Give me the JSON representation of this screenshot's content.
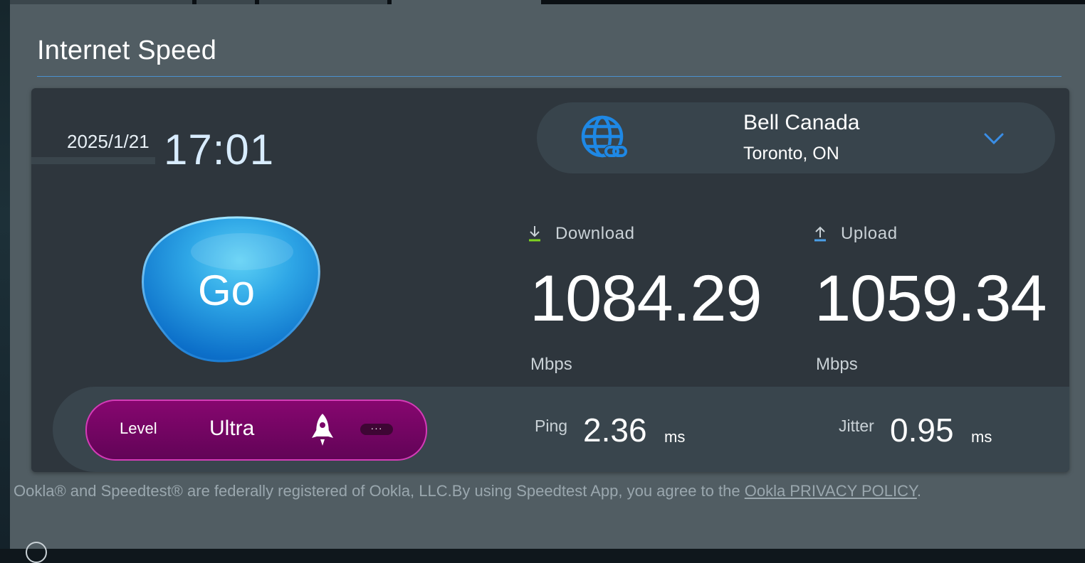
{
  "section": {
    "title": "Internet Speed"
  },
  "datetime": {
    "date": "2025/1/21",
    "time": "17:01"
  },
  "server": {
    "isp": "Bell Canada",
    "location": "Toronto, ON",
    "icon": "globe-link-icon",
    "dropdown_icon": "chevron-down-icon"
  },
  "go_button": {
    "label": "Go"
  },
  "download": {
    "label": "Download",
    "value": "1084.29",
    "unit": "Mbps",
    "icon": "download-arrow-icon"
  },
  "upload": {
    "label": "Upload",
    "value": "1059.34",
    "unit": "Mbps",
    "icon": "upload-arrow-icon"
  },
  "level": {
    "label": "Level",
    "value": "Ultra",
    "icon": "rocket-icon",
    "more_label": "···"
  },
  "ping": {
    "label": "Ping",
    "value": "2.36",
    "unit": "ms"
  },
  "jitter": {
    "label": "Jitter",
    "value": "0.95",
    "unit": "ms"
  },
  "footer": {
    "text": "Ookla® and Speedtest® are federally registered of Ookla, LLC.By using Speedtest App, you agree to the ",
    "link_text": "Ookla PRIVACY POLICY",
    "suffix": "."
  },
  "colors": {
    "accent_blue": "#1e88e5",
    "level_magenta": "#86066f",
    "download_green": "#7ed321",
    "upload_blue": "#4a9fe8"
  }
}
